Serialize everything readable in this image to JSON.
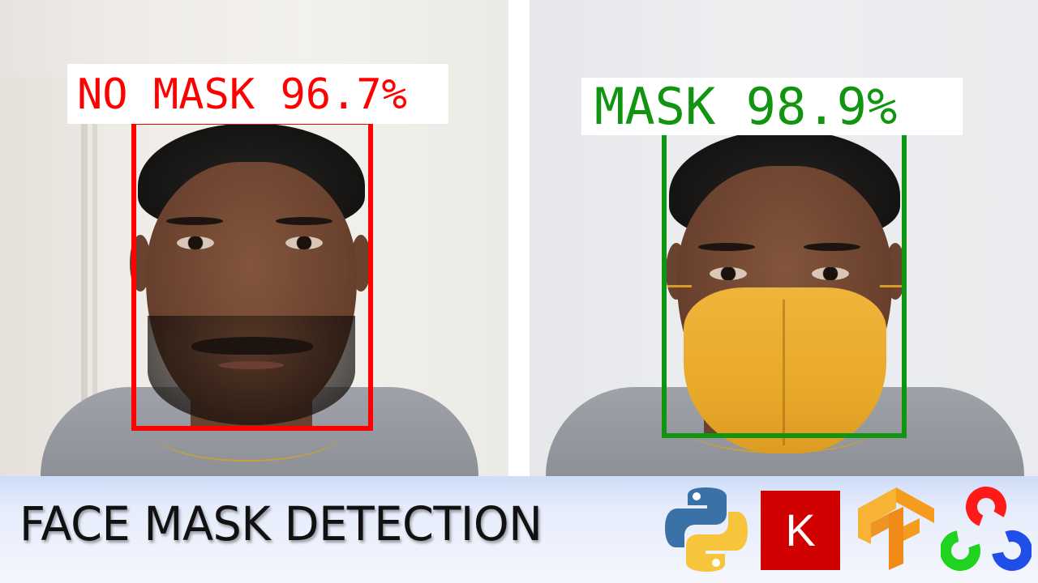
{
  "detections": [
    {
      "label": "NO MASK",
      "confidence": "96.7%",
      "text": "NO MASK 96.7%",
      "color": "#ff0000"
    },
    {
      "label": "MASK",
      "confidence": "98.9%",
      "text": "MASK 98.9%",
      "color": "#119511"
    }
  ],
  "banner": {
    "title": "FACE MASK DETECTION",
    "background": "#dde6fa"
  },
  "logos": [
    {
      "name": "python-icon",
      "text": ""
    },
    {
      "name": "keras-icon",
      "text": "K"
    },
    {
      "name": "tensorflow-icon",
      "text": ""
    },
    {
      "name": "opencv-icon",
      "text": ""
    }
  ]
}
